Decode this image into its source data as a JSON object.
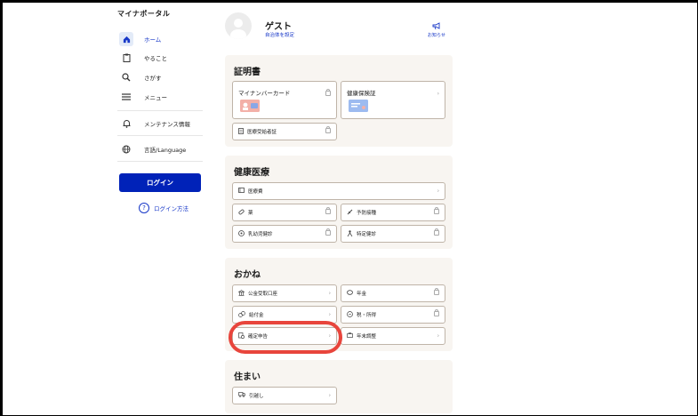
{
  "app": {
    "title": "マイナポータル"
  },
  "sidebar": {
    "items": [
      {
        "label": "ホーム",
        "icon": "home-icon",
        "active": true
      },
      {
        "label": "やること",
        "icon": "clipboard-icon"
      },
      {
        "label": "さがす",
        "icon": "search-icon"
      },
      {
        "label": "メニュー",
        "icon": "menu-icon"
      },
      {
        "label": "メンテナンス情報",
        "icon": "bell-icon"
      },
      {
        "label": "言語/Language",
        "icon": "globe-icon"
      }
    ],
    "login_button": "ログイン",
    "login_help": "ログイン方法"
  },
  "header": {
    "user_name": "ゲスト",
    "user_sub": "自治体を設定",
    "notice": "お知らせ"
  },
  "sections": {
    "certificates": {
      "title": "証明書",
      "cards": [
        {
          "label": "マイナンバーカード",
          "locked": true,
          "icon": "id-card-icon"
        },
        {
          "label": "健康保険証",
          "locked": false,
          "icon": "insurance-card-icon"
        },
        {
          "label": "医療受給者証",
          "locked": true,
          "icon": "document-icon"
        }
      ]
    },
    "health": {
      "title": "健康医療",
      "cards": [
        {
          "label": "医療費",
          "locked": false,
          "icon": "wallet-icon"
        },
        {
          "label": "薬",
          "locked": true,
          "icon": "pill-icon"
        },
        {
          "label": "予防接種",
          "locked": true,
          "icon": "syringe-icon"
        },
        {
          "label": "乳幼児健診",
          "locked": true,
          "icon": "baby-icon"
        },
        {
          "label": "特定健診",
          "locked": true,
          "icon": "person-icon"
        }
      ]
    },
    "money": {
      "title": "おかね",
      "cards": [
        {
          "label": "公金受取口座",
          "locked": false,
          "icon": "bank-icon"
        },
        {
          "label": "年金",
          "locked": true,
          "icon": "piggy-bank-icon"
        },
        {
          "label": "給付金",
          "locked": false,
          "icon": "coins-icon"
        },
        {
          "label": "税・所得",
          "locked": true,
          "icon": "yen-icon"
        },
        {
          "label": "確定申告",
          "locked": false,
          "icon": "tax-return-icon"
        },
        {
          "label": "年末調整",
          "locked": false,
          "icon": "briefcase-icon"
        }
      ]
    },
    "housing": {
      "title": "住まい",
      "cards": [
        {
          "label": "引越し",
          "locked": false,
          "icon": "truck-icon"
        }
      ]
    }
  },
  "colors": {
    "accent": "#0022b8",
    "link": "#1838c8",
    "section_bg": "#f8f5f1",
    "highlight": "#e8453c"
  }
}
